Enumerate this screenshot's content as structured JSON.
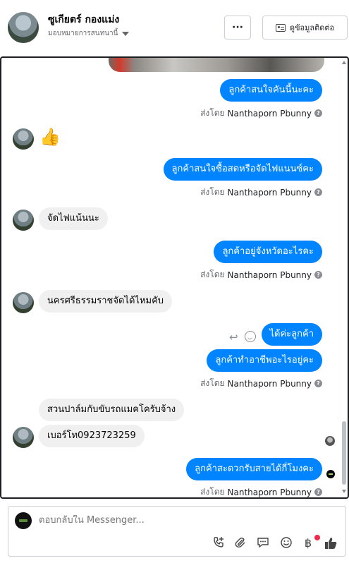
{
  "header": {
    "contact_name": "ซูเกียตร์ กองแม่ง",
    "assign_label": "มอบหมายการสนทนานี้",
    "more_label": "···",
    "contact_info_label": "ดูข้อมูลติดต่อ"
  },
  "messages": [
    {
      "type": "out",
      "text": "ลูกค้าสนใจคันนี้นะคะ"
    },
    {
      "type": "meta",
      "prefix": "ส่งโดย",
      "sender": "Nanthaporn Pbunny"
    },
    {
      "type": "in",
      "emoji": "👍"
    },
    {
      "type": "out",
      "text": "ลูกค้าสนใจซื้อสดหรือจัดไฟแนนซ์คะ"
    },
    {
      "type": "meta",
      "prefix": "ส่งโดย",
      "sender": "Nanthaporn Pbunny"
    },
    {
      "type": "in",
      "text": "จัดไฟแน้นนะ"
    },
    {
      "type": "out",
      "text": "ลูกค้าอยู่จังหวัดอะไรคะ"
    },
    {
      "type": "meta",
      "prefix": "ส่งโดย",
      "sender": "Nanthaporn Pbunny"
    },
    {
      "type": "in",
      "text": "นครศรีธรรมราชจัดได้ไหมคับ"
    },
    {
      "type": "out",
      "text": "ได้ค่ะลูกค้า"
    },
    {
      "type": "out",
      "text": "ลูกค้าทำอาชีพอะไรอยู่คะ"
    },
    {
      "type": "meta",
      "prefix": "ส่งโดย",
      "sender": "Nanthaporn Pbunny"
    },
    {
      "type": "in",
      "text": "สวนปาล์มกับขับรถแมคโครับจ้าง"
    },
    {
      "type": "in",
      "text": "เบอร์โท0923723259"
    },
    {
      "type": "out",
      "text": "ลูกค้าสะดวกรับสายได้กี่โมงคะ"
    },
    {
      "type": "meta",
      "prefix": "ส่งโดย",
      "sender": "Nanthaporn Pbunny"
    }
  ],
  "composer": {
    "placeholder": "ตอบกลับใน Messenger..."
  },
  "icons": {
    "call": "phone-plus-icon",
    "attach": "paperclip-icon",
    "saved_replies": "chat-bubble-icon",
    "emoji": "smile-icon",
    "payment": "baht-icon",
    "like": "thumbs-up-icon"
  },
  "colors": {
    "outgoing_bubble": "#0084ff",
    "incoming_bubble": "#f0f0f0",
    "notification_dot": "#f02849"
  }
}
